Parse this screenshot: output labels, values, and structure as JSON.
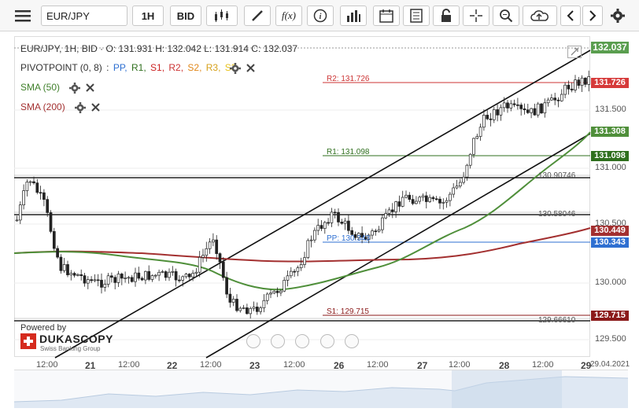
{
  "toolbar": {
    "menu_icon": "hamburger-menu-icon",
    "symbol": "EUR/JPY",
    "timeframe": "1H",
    "side": "BID",
    "icons": [
      "candlestick-type-icon",
      "pencil-draw-icon",
      "function-icon",
      "info-icon",
      "volume-bars-icon",
      "calendar-icon",
      "news-icon",
      "lock-icon",
      "crosshair-icon",
      "zoom-icon",
      "upload-cloud-icon",
      "prev-icon",
      "next-icon",
      "settings-icon"
    ],
    "function_label": "f(x)"
  },
  "ohlc": "EUR/JPY, 1H, BID · O: 131.931 H: 132.042 L: 131.914 C: 132.037",
  "pivot": {
    "name": "PIVOTPOINT (0, 8)",
    "sep": ":",
    "pp": "PP,",
    "r1": "R1,",
    "s1": "S1,",
    "r2": "R2,",
    "s2": "S2,",
    "r3": "R3,",
    "s3": "S3"
  },
  "sma50": "SMA (50)",
  "sma200": "SMA (200)",
  "levels": {
    "r2": "R2: 131.726",
    "r1": "R1: 131.098",
    "pp": "PP: 130.343",
    "s1": "S1: 129.715",
    "h1": "130.90746",
    "h2": "130.58046",
    "h3": "129.66610"
  },
  "price_labels": {
    "current": "132.037",
    "r2": "131.726",
    "sma50": "131.308",
    "r1": "131.098",
    "sma200": "130.449",
    "pp": "130.343",
    "s1": "129.715"
  },
  "y_axis": [
    "131.500",
    "131.000",
    "130.500",
    "130.000",
    "129.500"
  ],
  "x_axis": {
    "times": [
      "12:00",
      "12:00",
      "12:00",
      "12:00",
      "12:00",
      "12:00",
      "12:00"
    ],
    "days": [
      "21",
      "22",
      "23",
      "26",
      "27",
      "28",
      "29"
    ],
    "end_date": "29.04.2021"
  },
  "branding": {
    "powered": "Powered by",
    "name": "DUKASCOPY",
    "sub": "Swiss Banking Group"
  },
  "colors": {
    "r2": "#cc3333",
    "r1": "#2f6f1e",
    "pp": "#2e6fd1",
    "s1": "#8b1a1a",
    "sma50": "#4f8f3a",
    "sma200": "#a33030",
    "current": "#3c8f3c"
  }
}
